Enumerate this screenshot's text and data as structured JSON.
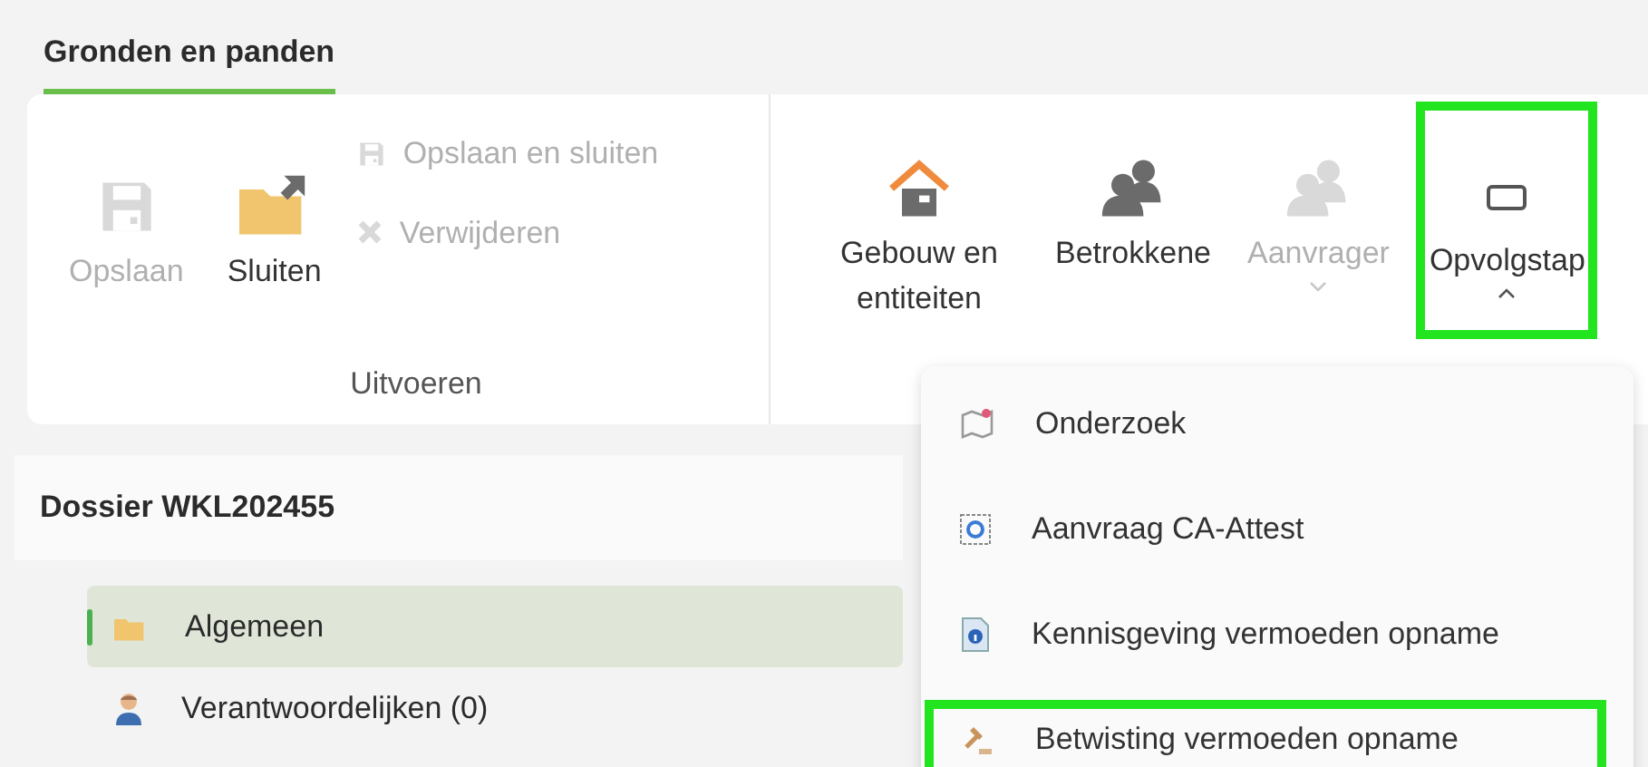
{
  "tab": {
    "label": "Gronden en panden",
    "selected": true
  },
  "ribbon": {
    "groups": [
      {
        "label": "Uitvoeren",
        "large_buttons": [
          {
            "kind": "save",
            "label": "Opslaan",
            "disabled": true
          },
          {
            "kind": "folder",
            "label": "Sluiten",
            "disabled": false
          }
        ],
        "small_buttons": [
          {
            "kind": "save",
            "label": "Opslaan en sluiten",
            "disabled": true
          },
          {
            "kind": "delete",
            "label": "Verwijderen",
            "disabled": true
          }
        ]
      },
      {
        "large_buttons": [
          {
            "kind": "house",
            "label": "Gebouw en entiteiten",
            "disabled": false
          },
          {
            "kind": "people",
            "label": "Betrokkene",
            "disabled": false
          },
          {
            "kind": "people",
            "label": "Aanvrager",
            "disabled": true,
            "expanded": false
          },
          {
            "kind": "frame",
            "label": "Opvolgstap",
            "disabled": false,
            "expanded": true,
            "highlighted": true
          }
        ]
      }
    ]
  },
  "dossier": {
    "title": "Dossier WKL202455",
    "items": [
      {
        "kind": "folder",
        "label": "Algemeen",
        "selected": true
      },
      {
        "kind": "person",
        "label": "Verantwoordelijken (0)",
        "selected": false
      }
    ]
  },
  "dropdown": {
    "items": [
      {
        "kind": "map",
        "label": "Onderzoek",
        "highlighted": false
      },
      {
        "kind": "refresh",
        "label": "Aanvraag CA-Attest",
        "highlighted": false
      },
      {
        "kind": "info",
        "label": "Kennisgeving vermoeden opname",
        "highlighted": false
      },
      {
        "kind": "gavel",
        "label": "Betwisting vermoeden opname",
        "highlighted": true
      }
    ]
  }
}
